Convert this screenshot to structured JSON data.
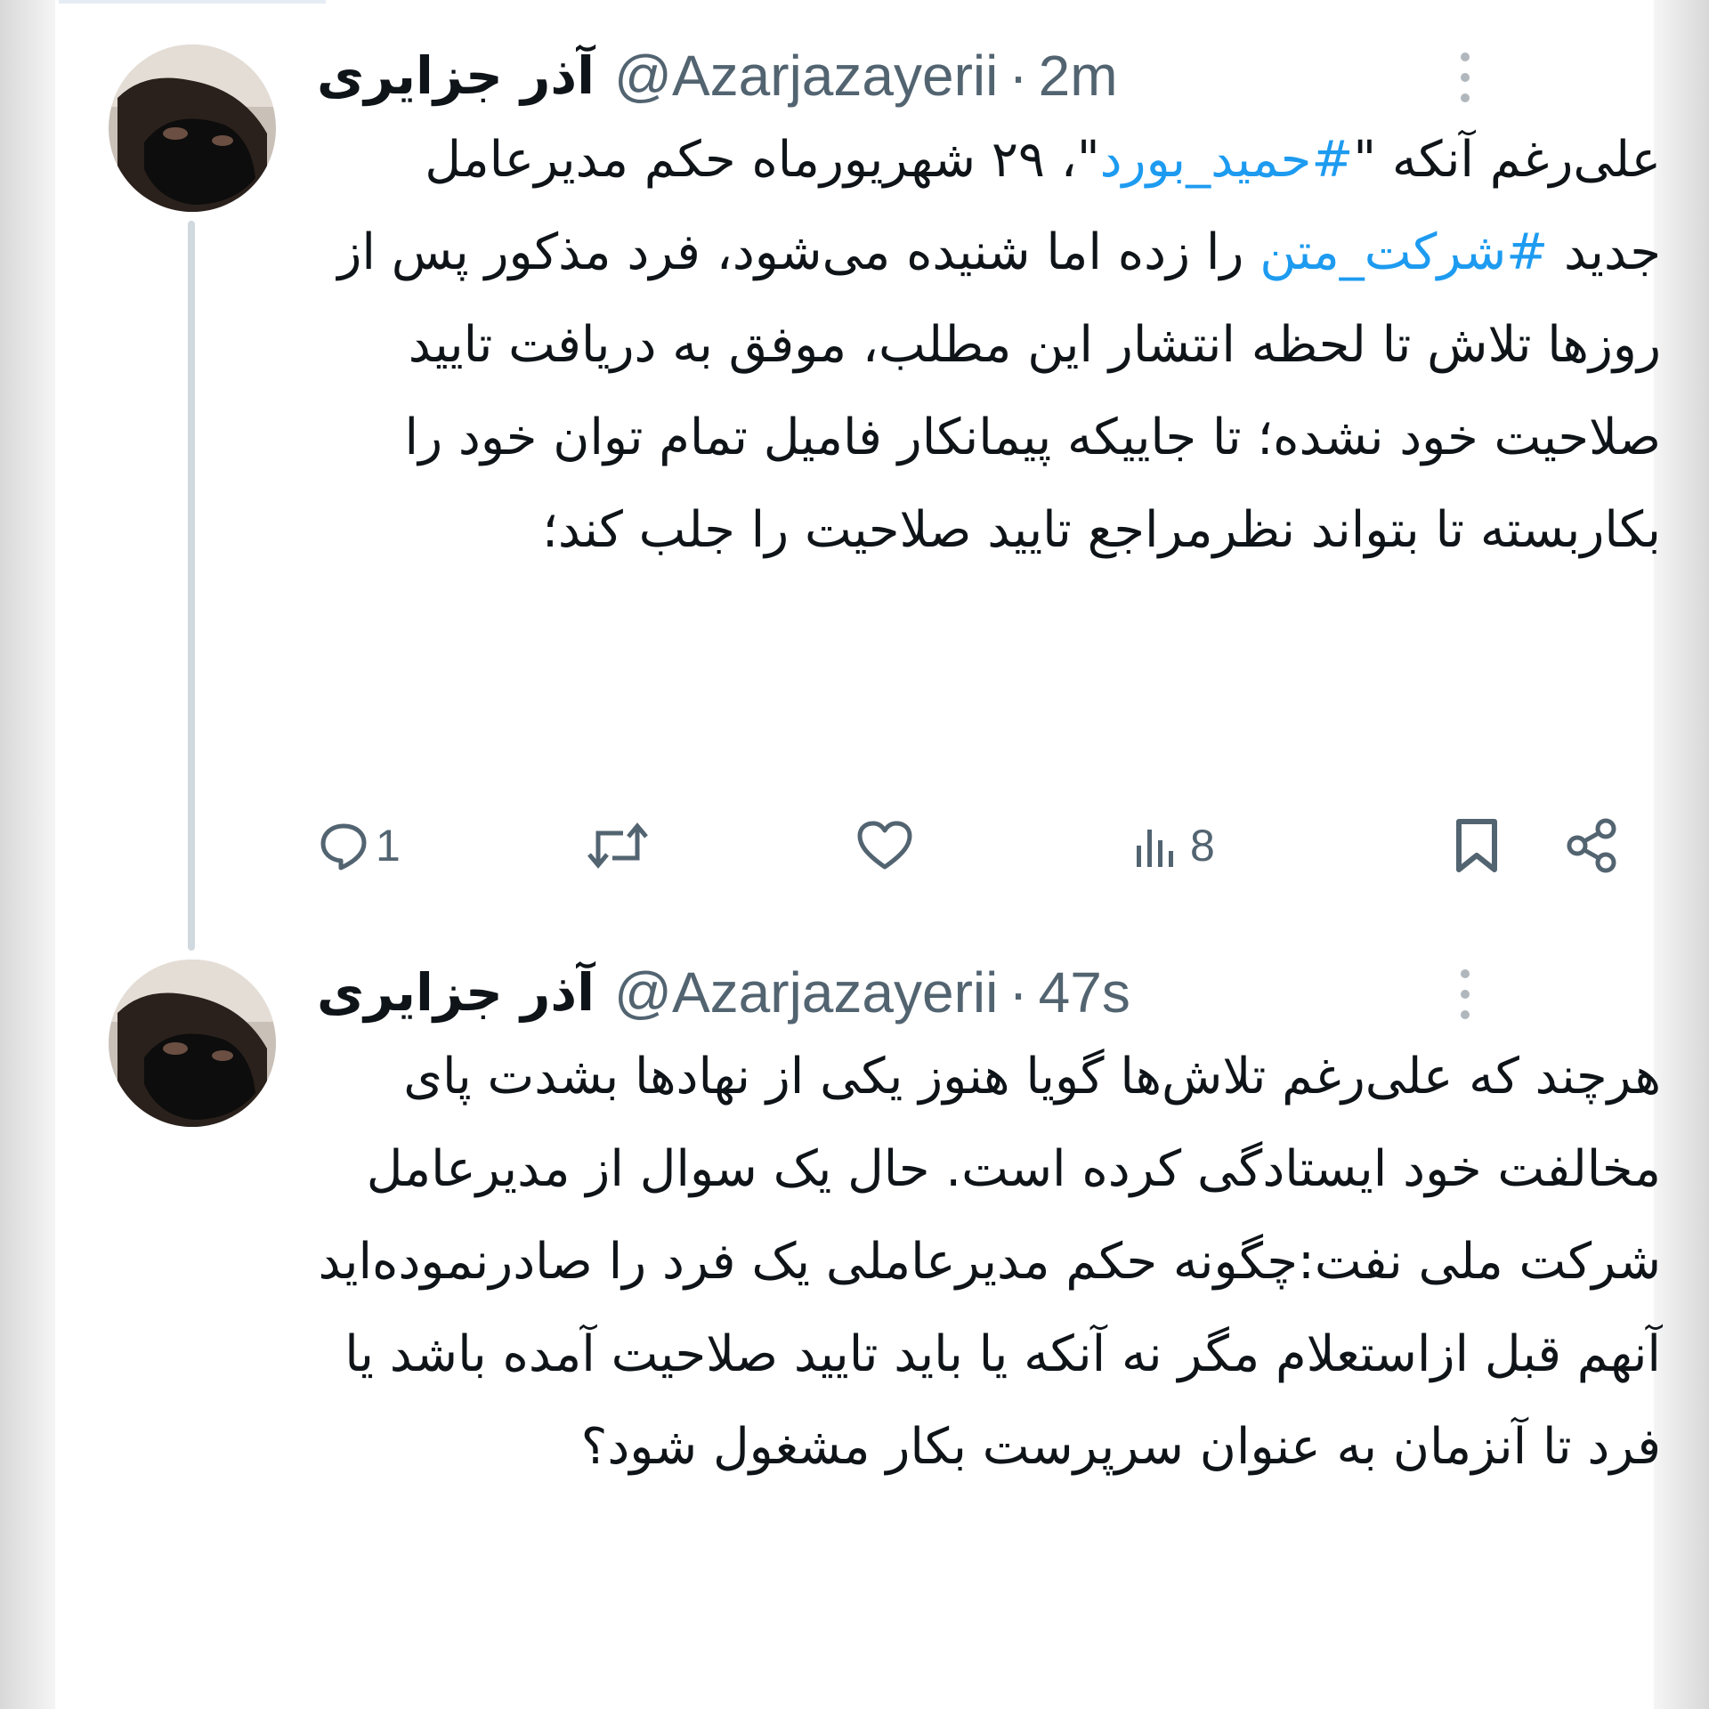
{
  "colors": {
    "text": "#0f1419",
    "secondary": "#536471",
    "hashtag": "#1d9bf0",
    "thread_line": "#cfd9de"
  },
  "tweets": [
    {
      "author": {
        "display_name": "آذر جزایری",
        "handle": "@Azarjazayerii",
        "separator": "·",
        "time": "2m"
      },
      "text": {
        "prefix": "علی‌رغم آنکه \"",
        "hashtag1": "#حمید_بورد",
        "middle": "\"، ۲۹ شهریورماه حکم مدیرعامل جدید ",
        "hashtag2": "#شرکت_متن",
        "suffix": " را زده اما شنیده می‌شود، فرد مذکور پس از روزها تلاش تا لحظه انتشار این مطلب، موفق به دریافت تایید صلاحیت خود نشده؛ تا جاییکه پیمانکار فامیل تمام توان خود را بکاربسته تا بتواند نظرمراجع تایید صلاحیت را جلب کند؛"
      },
      "actions": {
        "reply_icon": "reply-icon",
        "reply_count": "1",
        "retweet_icon": "retweet-icon",
        "like_icon": "like-icon",
        "views_icon": "views-icon",
        "views_count": "8",
        "bookmark_icon": "bookmark-icon",
        "share_icon": "share-icon"
      },
      "more_icon": "more-vertical-icon"
    },
    {
      "author": {
        "display_name": "آذر جزایری",
        "handle": "@Azarjazayerii",
        "separator": "·",
        "time": "47s"
      },
      "text": {
        "body": "هرچند که علی‌رغم تلاش‌ها گویا هنوز یکی از نهادها بشدت پای مخالفت خود ایستادگی کرده است. حال یک سوال از مدیرعامل شرکت ملی نفت:چگونه حکم مدیرعاملی یک فرد را صادرنموده‌اید آنهم قبل ازاستعلام مگر نه آنکه یا باید تایید صلاحیت آمده باشد یا فرد تا آنزمان به عنوان سرپرست بکار مشغول شود؟"
      },
      "more_icon": "more-vertical-icon"
    }
  ]
}
